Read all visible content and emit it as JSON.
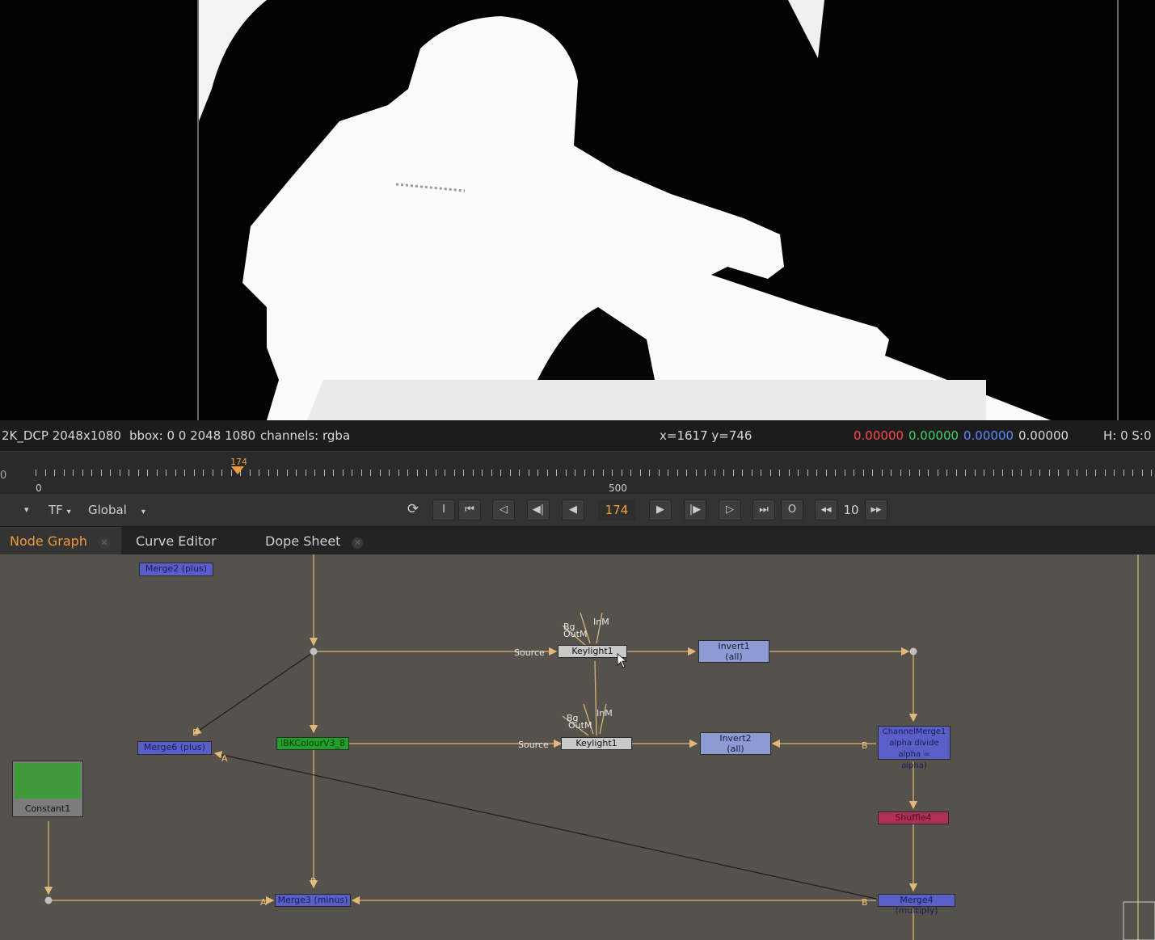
{
  "viewer": {
    "format": "2K_DCP 2048x1080",
    "bbox": "bbox: 0 0 2048 1080",
    "channels": "channels: rgba",
    "coords": "x=1617 y=746",
    "pixel": {
      "r": "0.00000",
      "g": "0.00000",
      "b": "0.00000",
      "a": "0.00000"
    },
    "hs": "H:  0 S:0"
  },
  "timeline": {
    "left_value": "0",
    "start_label": "0",
    "mid_label": "500",
    "current_marker": "174"
  },
  "controls": {
    "dropdown_left": "",
    "tf_label": "TF",
    "global_label": "Global",
    "in_label": "I",
    "out_label": "O",
    "frame": "174",
    "increment": "10"
  },
  "tabs": [
    {
      "label": "Node Graph",
      "active": true
    },
    {
      "label": "Curve Editor",
      "active": false
    },
    {
      "label": "Dope Sheet",
      "active": false
    }
  ],
  "graph": {
    "nodes": {
      "merge2": "Merge2 (plus)",
      "merge6": "Merge6 (plus)",
      "constant": "Constant1",
      "ibk": "IBKColourV3_8",
      "keylight_a": "Keylight1",
      "keylight_b": "Keylight1",
      "invert1": "Invert1",
      "invert1_sub": "(all)",
      "invert2": "Invert2",
      "invert2_sub": "(all)",
      "channelmerge_l1": "ChannelMerge1",
      "channelmerge_l2": "alpha divide alpha =",
      "channelmerge_l3": "alpha)",
      "shuffle": "Shuffle4",
      "merge3": "Merge3 (minus)",
      "merge4": "Merge4 (multiply)"
    },
    "labels": {
      "source_a": "Source",
      "source_b": "Source",
      "inm_a": "InM",
      "inm_b": "InM",
      "bg_a": "Bg",
      "outm_a": "OutM",
      "bg_b": "Bg",
      "outm_b": "OutM",
      "b_merge6": "B",
      "a_merge6": "A",
      "a_merge3": "A",
      "b_merge3": "B",
      "b_merge4": "B",
      "b_channelmerge": "B"
    }
  },
  "colors": {
    "accent": "#f29a3a",
    "pipe": "#d9b27a",
    "graph_bg": "#54524a"
  }
}
